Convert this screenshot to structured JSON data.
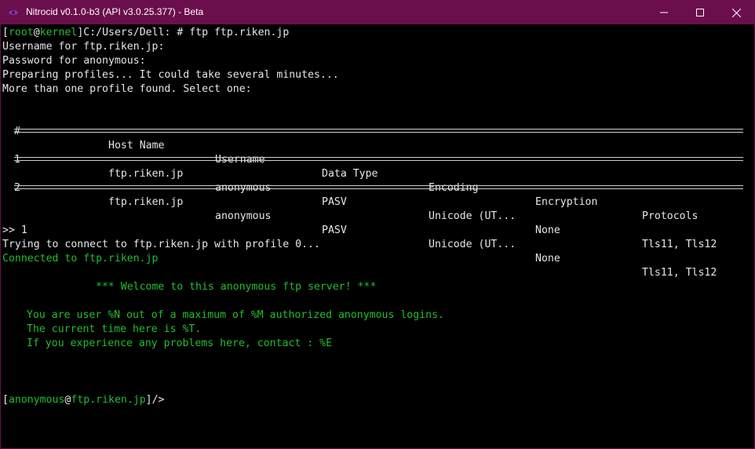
{
  "window": {
    "title": "Nitrocid v0.1.0-b3 (API v3.0.25.377) - Beta"
  },
  "prompt1": {
    "bracket_open": "[",
    "user": "root",
    "at": "@",
    "host": "kernel",
    "bracket_close": "]",
    "path_cmd": "C:/Users/Dell: # ftp ftp.riken.jp"
  },
  "lines": {
    "username": "Username for ftp.riken.jp:",
    "password": "Password for anonymous:",
    "preparing": "Preparing profiles... It could take several minutes...",
    "more": "More than one profile found. Select one:"
  },
  "table": {
    "headers": [
      "#",
      "Host Name",
      "Username",
      "Data Type",
      "Encoding",
      "Encryption",
      "Protocols"
    ],
    "rows": [
      [
        "1",
        "ftp.riken.jp",
        "anonymous",
        "PASV",
        "Unicode (UT...",
        "None",
        "Tls11, Tls12"
      ],
      [
        "2",
        "ftp.riken.jp",
        "anonymous",
        "PASV",
        "Unicode (UT...",
        "None",
        "Tls11, Tls12"
      ]
    ]
  },
  "selection": {
    "input": ">> 1",
    "trying": "Trying to connect to ftp.riken.jp with profile 0...",
    "connected": "Connected to ftp.riken.jp"
  },
  "banner": {
    "welcome": "*** Welcome to this anonymous ftp server! ***",
    "line1": "You are user %N out of a maximum of %M authorized anonymous logins.",
    "line2": "The current time here is %T.",
    "line3": "If you experience any problems here, contact : %E"
  },
  "prompt2": {
    "bracket_open": "[",
    "user": "anonymous",
    "at": "@",
    "host": "ftp.riken.jp",
    "bracket_close": "]",
    "path": "/>"
  },
  "colors": {
    "titlebar": "#6b0f4c",
    "green": "#1fbf2a",
    "text": "#e6e6e6"
  }
}
